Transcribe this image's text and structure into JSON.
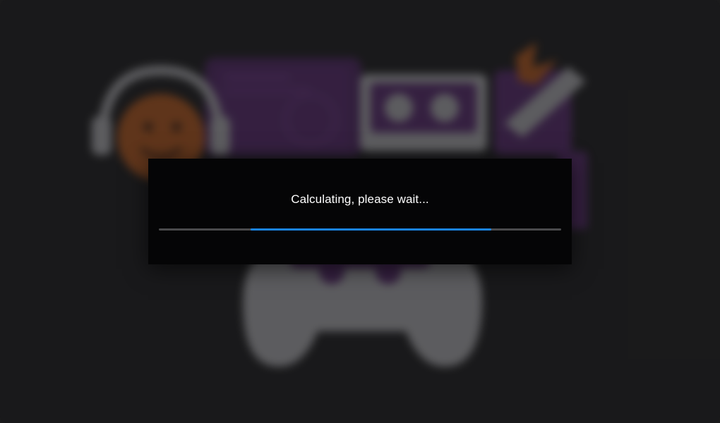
{
  "dialog": {
    "message": "Calculating, please wait..."
  },
  "progress": {
    "indeterminate": true,
    "segment_start_fraction": 0.228,
    "segment_end_fraction": 0.827
  },
  "colors": {
    "background": "#1d1d1e",
    "dialog_background": "#050506",
    "message_text": "#ffffff",
    "progress_track": "#4a4a4c",
    "progress_fill": "#1a84e6",
    "artwork_purple": "#6a2f86",
    "artwork_orange": "#e06a1e",
    "artwork_grey": "#d8d8dc"
  },
  "background_art": {
    "icons": [
      "headset-emoji-icon",
      "video-cassette-icon",
      "paint-tube-icon",
      "gamepad-icon",
      "document-panel-icon"
    ]
  }
}
